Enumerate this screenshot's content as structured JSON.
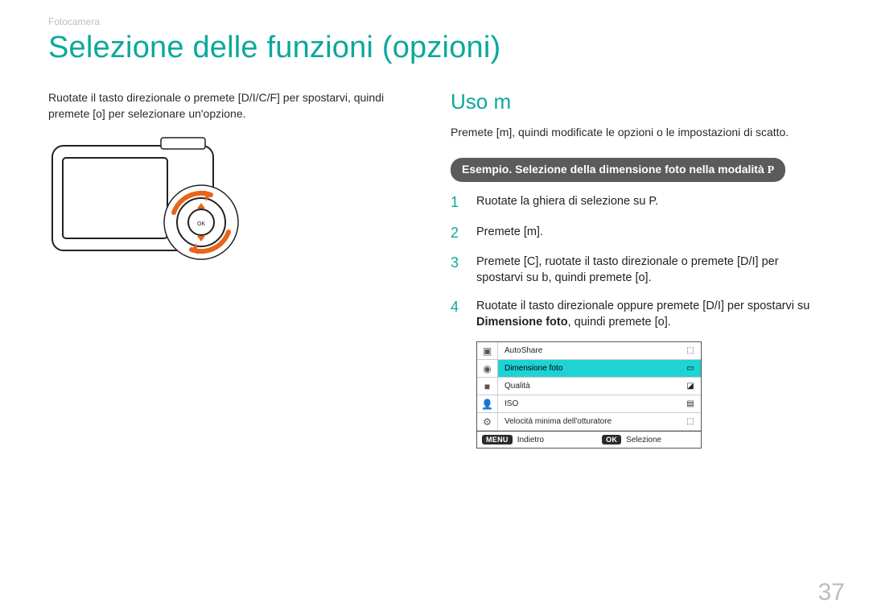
{
  "breadcrumb": "Fotocamera",
  "title": "Selezione delle funzioni (opzioni)",
  "left": {
    "intro": "Ruotate il tasto direzionale o premete [D/I/C/F] per spostarvi, quindi premete [o] per selezionare un'opzione."
  },
  "right": {
    "heading": "Uso m",
    "intro": "Premete [m], quindi modificate le opzioni o le impostazioni di scatto.",
    "example_label": "Esempio. Selezione della dimensione foto nella modalità ",
    "example_mode": "P",
    "steps": [
      {
        "num": "1",
        "text": "Ruotate la ghiera di selezione su P."
      },
      {
        "num": "2",
        "text": "Premete [m]."
      },
      {
        "num": "3",
        "text": "Premete [C], ruotate il tasto direzionale o premete [D/I] per spostarvi su b, quindi premete [o]."
      },
      {
        "num": "4",
        "html": "Ruotate il tasto direzionale oppure premete [D/I] per spostarvi su <b>Dimensione foto</b>, quindi premete [o]."
      }
    ]
  },
  "menu": {
    "rows": [
      {
        "tab_icon": "camera-icon",
        "label": "AutoShare",
        "value_icon": "off-icon",
        "selected": false
      },
      {
        "tab_icon": "camera2-icon",
        "label": "Dimensione foto",
        "value_icon": "size-icon",
        "selected": true
      },
      {
        "tab_icon": "video-icon",
        "label": "Qualità",
        "value_icon": "quality-icon",
        "selected": false
      },
      {
        "tab_icon": "person-icon",
        "label": "ISO",
        "value_icon": "iso-icon",
        "selected": false
      },
      {
        "tab_icon": "gear-icon",
        "label": "Velocità minima dell'otturatore",
        "value_icon": "shutter-icon",
        "selected": false
      }
    ],
    "footer": {
      "menu_btn": "MENU",
      "back": "Indietro",
      "ok_btn": "OK",
      "select": "Selezione"
    }
  },
  "page_number": "37"
}
